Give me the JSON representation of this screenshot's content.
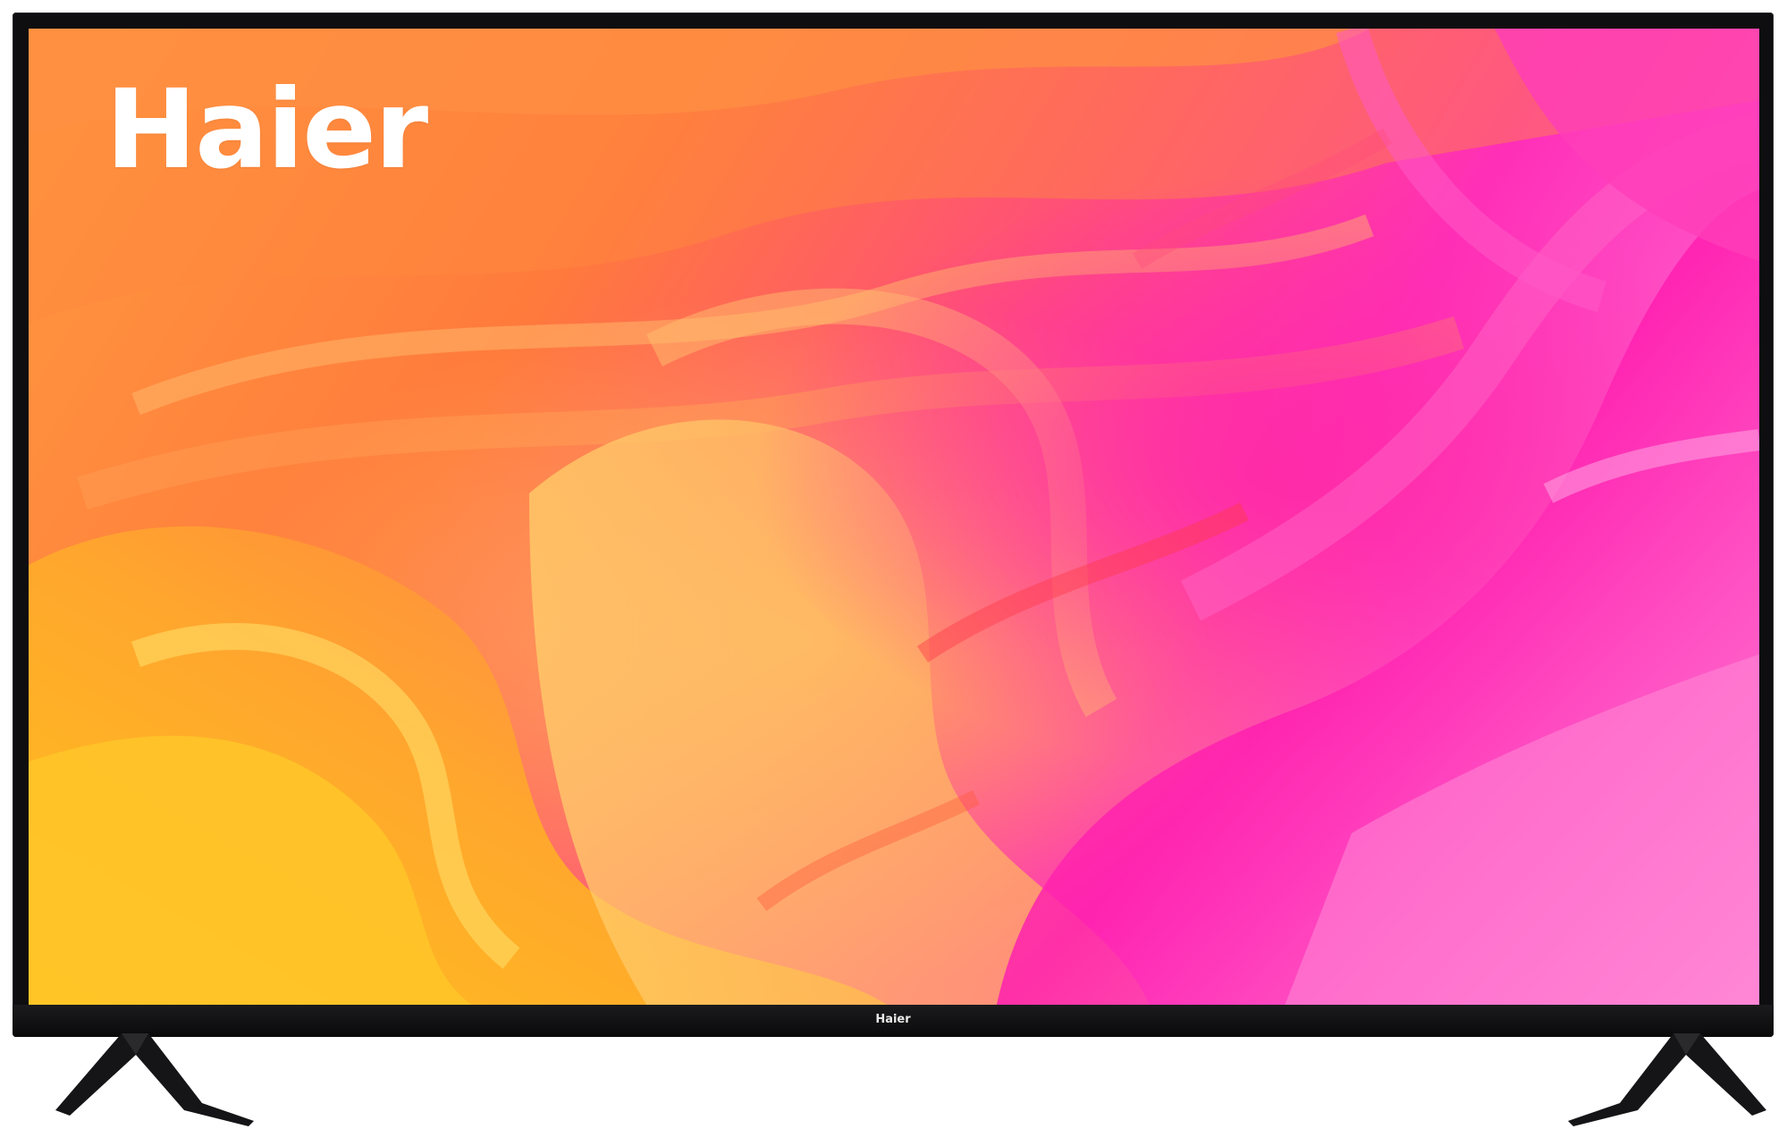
{
  "product": {
    "screen_logo": "Haier",
    "bezel_logo": "Haier"
  },
  "colors": {
    "bezel": "#0e0e10",
    "screen_orange": "#ff8a3d",
    "screen_yellow": "#ffc21a",
    "screen_magenta": "#ff2fb8",
    "screen_pink": "#ff7fd0",
    "logo_text": "#ffffff"
  },
  "icons": [
    "tv-stand-left-icon",
    "tv-stand-right-icon"
  ]
}
